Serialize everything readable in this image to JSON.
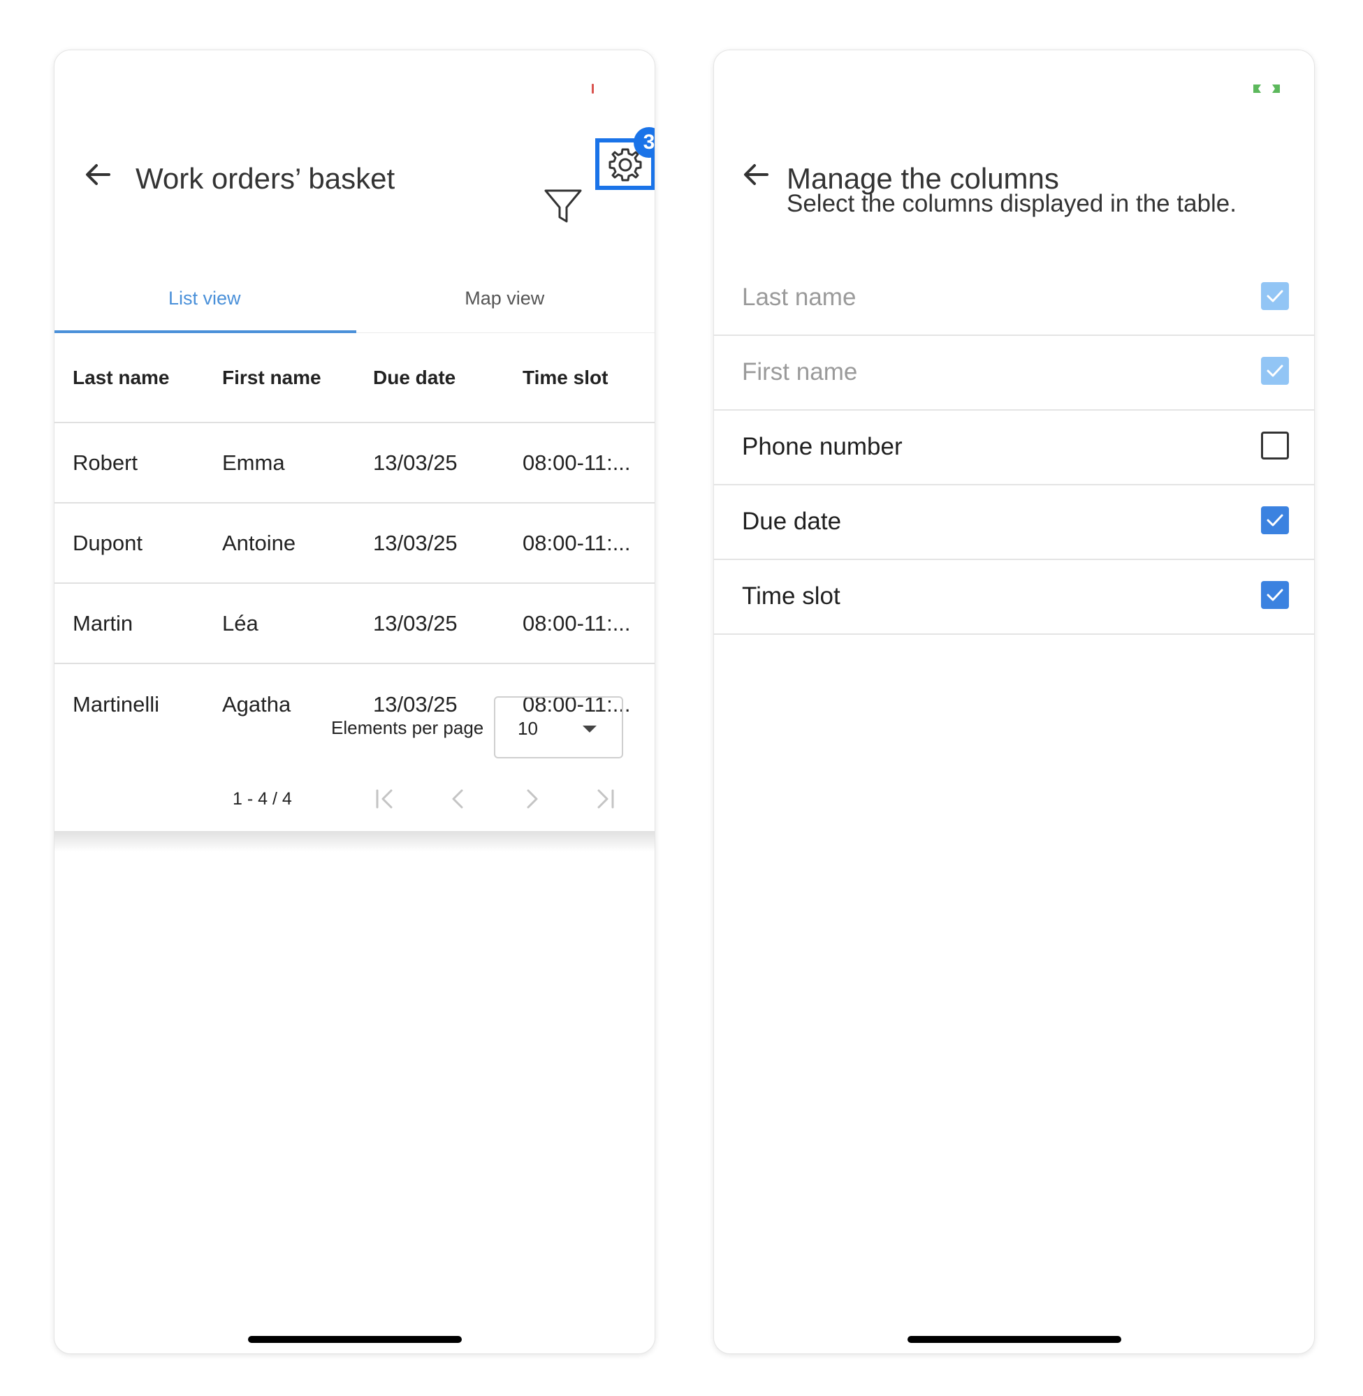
{
  "left_screen": {
    "title": "Work orders’ basket",
    "settings_badge": "3",
    "tabs": [
      {
        "label": "List view",
        "active": true
      },
      {
        "label": "Map view",
        "active": false
      }
    ],
    "table": {
      "headers": [
        "Last name",
        "First name",
        "Due date",
        "Time slot"
      ],
      "rows": [
        [
          "Robert",
          "Emma",
          "13/03/25",
          "08:00-11:..."
        ],
        [
          "Dupont",
          "Antoine",
          "13/03/25",
          "08:00-11:..."
        ],
        [
          "Martin",
          "Léa",
          "13/03/25",
          "08:00-11:..."
        ],
        [
          "Martinelli",
          "Agatha",
          "13/03/25",
          "08:00-11:..."
        ]
      ]
    },
    "pagination": {
      "per_page_label": "Elements per page",
      "per_page_value": "10",
      "range": "1 - 4 / 4"
    }
  },
  "right_screen": {
    "title": "Manage the columns",
    "subtitle": "Select the columns displayed in the table.",
    "columns": [
      {
        "label": "Last name",
        "checked": true,
        "disabled": true
      },
      {
        "label": "First name",
        "checked": true,
        "disabled": true
      },
      {
        "label": "Phone number",
        "checked": false,
        "disabled": false
      },
      {
        "label": "Due date",
        "checked": true,
        "disabled": false
      },
      {
        "label": "Time slot",
        "checked": true,
        "disabled": false
      }
    ]
  },
  "colors": {
    "accent_blue": "#1a73e8",
    "tab_active": "#4a90d9",
    "checkbox_checked": "#3b82e0",
    "checkbox_disabled": "#92c5f5"
  },
  "icons": [
    "back-arrow-icon",
    "filter-icon",
    "gear-icon",
    "first-page-icon",
    "prev-page-icon",
    "next-page-icon",
    "last-page-icon",
    "check-icon",
    "dropdown-caret-icon"
  ]
}
